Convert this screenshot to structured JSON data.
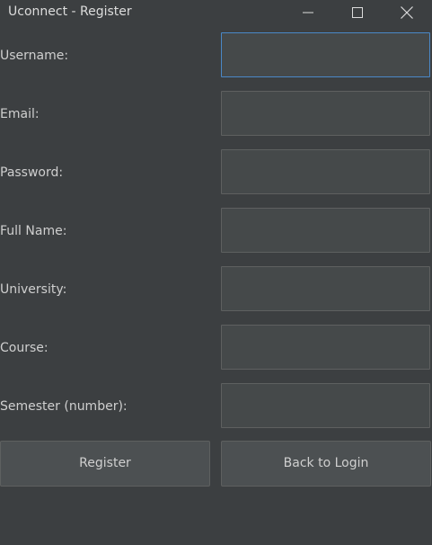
{
  "window": {
    "title": "Uconnect - Register"
  },
  "form": {
    "fields": [
      {
        "label": "Username:",
        "value": ""
      },
      {
        "label": "Email:",
        "value": ""
      },
      {
        "label": "Password:",
        "value": ""
      },
      {
        "label": "Full Name:",
        "value": ""
      },
      {
        "label": "University:",
        "value": ""
      },
      {
        "label": "Course:",
        "value": ""
      },
      {
        "label": "Semester (number):",
        "value": ""
      }
    ]
  },
  "actions": {
    "register_label": "Register",
    "back_label": "Back to Login"
  },
  "colors": {
    "background": "#3c3f41",
    "field_background": "#45494a",
    "focus_border": "#4a88c7",
    "button_background": "#4c5052"
  },
  "icons": {
    "minimize": "minimize-icon",
    "maximize": "maximize-icon",
    "close": "close-icon"
  }
}
